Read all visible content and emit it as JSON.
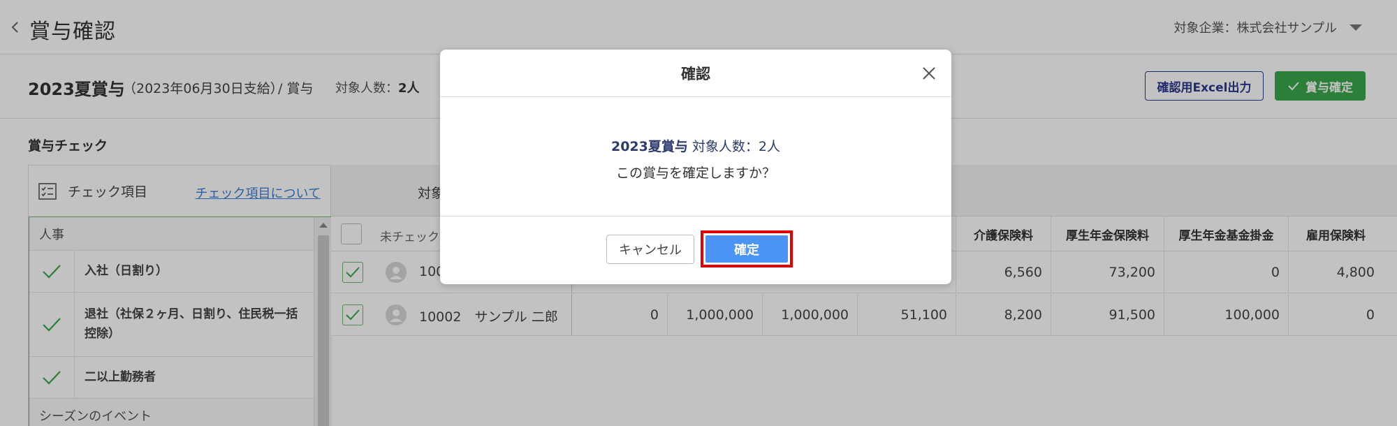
{
  "header": {
    "title": "賞与確認",
    "company_label": "対象企業：株式会社サンプル"
  },
  "summary": {
    "bonus_name": "2023夏賞与",
    "bonus_date": "（2023年06月30日支給）",
    "bonus_type": "/ 賞与",
    "target_label": "対象人数：",
    "target_value": "2人",
    "excel_button": "確認用Excel出力",
    "finalize_button": "賞与確定"
  },
  "check_section": {
    "title": "賞与チェック",
    "head_label": "チェック項目",
    "link": "チェック項目について",
    "groups": [
      {
        "label": "人事",
        "items": [
          {
            "text": "入社（日割り）",
            "checked": true
          },
          {
            "text": "退社（社保２ヶ月、日割り、住民税一括控除）",
            "checked": true
          },
          {
            "text": "二以上勤務者",
            "checked": true
          }
        ]
      },
      {
        "label": "シーズンのイベント",
        "items": []
      }
    ]
  },
  "table": {
    "tab_label": "対象",
    "unchecked_label": "未チェック",
    "columns": [
      "介護保険料",
      "厚生年金保険料",
      "厚生年金基金掛金",
      "雇用保険料"
    ],
    "rows": [
      {
        "checked": true,
        "emp_text": "100",
        "values": [
          "6,560",
          "73,200",
          "0",
          "4,800"
        ]
      },
      {
        "checked": true,
        "emp_text": "10002　サンプル 二郎",
        "hidden_values": [
          "0",
          "1,000,000",
          "1,000,000",
          "51,100"
        ],
        "values": [
          "8,200",
          "91,500",
          "100,000",
          "0"
        ]
      }
    ]
  },
  "modal": {
    "title": "確認",
    "message_bold": "2023夏賞与",
    "message_count": " 対象人数：2人",
    "message_question": "この賞与を確定しますか？",
    "cancel_button": "キャンセル",
    "confirm_button": "確定",
    "highlight_color": "#e00000"
  },
  "colors": {
    "accent_green": "#3aa84a",
    "confirm_blue": "#4b94f5",
    "excel_border": "#2b3a8f",
    "link_blue": "#3c7dd6"
  }
}
